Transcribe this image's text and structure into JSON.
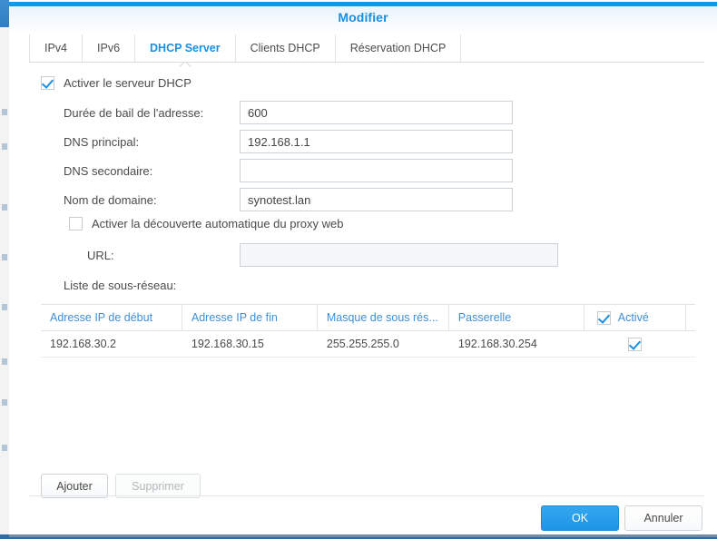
{
  "window": {
    "title": "Modifier",
    "accent_color": "#0d9ae8"
  },
  "tabs": [
    {
      "label": "IPv4",
      "active": false
    },
    {
      "label": "IPv6",
      "active": false
    },
    {
      "label": "DHCP Server",
      "active": true
    },
    {
      "label": "Clients DHCP",
      "active": false
    },
    {
      "label": "Réservation DHCP",
      "active": false
    }
  ],
  "form": {
    "enable_dhcp": {
      "label": "Activer le serveur DHCP",
      "checked": true
    },
    "lease_time": {
      "label": "Durée de bail de l'adresse:",
      "value": "600"
    },
    "dns_primary": {
      "label": "DNS principal:",
      "value": "192.168.1.1"
    },
    "dns_secondary": {
      "label": "DNS secondaire:",
      "value": ""
    },
    "domain_name": {
      "label": "Nom de domaine:",
      "value": "synotest.lan"
    },
    "proxy_autodiscovery": {
      "label": "Activer la découverte automatique du proxy web",
      "checked": false
    },
    "proxy_url": {
      "label": "URL:",
      "value": "",
      "disabled": true
    },
    "subnet_list_label": "Liste de sous-réseau:"
  },
  "table": {
    "columns": [
      "Adresse IP de début",
      "Adresse IP de fin",
      "Masque de sous rés...",
      "Passerelle",
      "Activé"
    ],
    "header_checkbox_checked": true,
    "rows": [
      {
        "start_ip": "192.168.30.2",
        "end_ip": "192.168.30.15",
        "netmask": "255.255.255.0",
        "gateway": "192.168.30.254",
        "enabled": true
      }
    ]
  },
  "actions": {
    "add": {
      "label": "Ajouter",
      "disabled": false
    },
    "delete": {
      "label": "Supprimer",
      "disabled": true
    }
  },
  "footer": {
    "ok": "OK",
    "cancel": "Annuler"
  }
}
